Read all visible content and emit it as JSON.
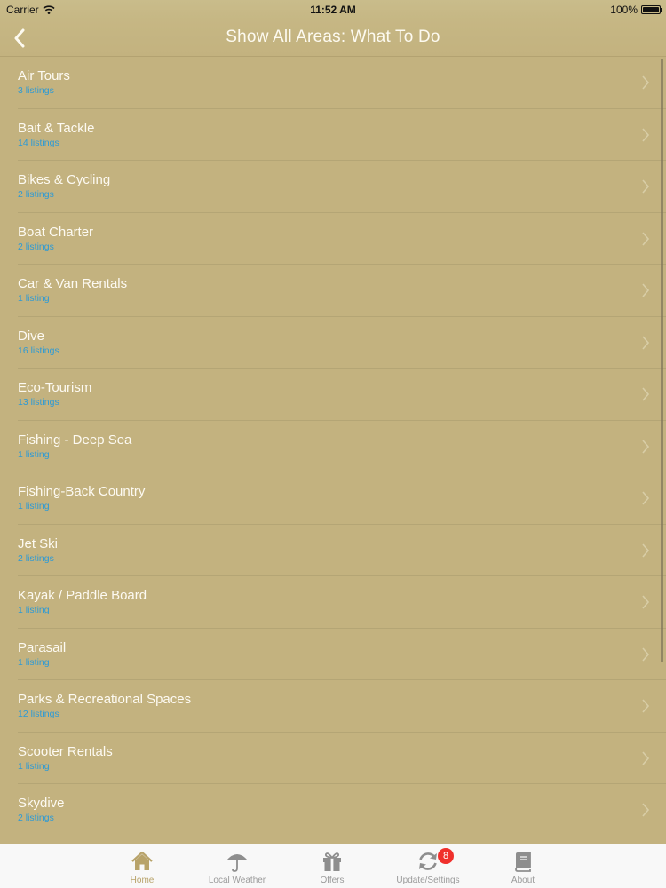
{
  "status_bar": {
    "carrier": "Carrier",
    "time": "11:52 AM",
    "battery": "100%"
  },
  "nav": {
    "title": "Show All Areas: What To Do"
  },
  "categories": [
    {
      "name": "Air Tours",
      "count": "3 listings"
    },
    {
      "name": "Bait & Tackle",
      "count": "14 listings"
    },
    {
      "name": "Bikes & Cycling",
      "count": "2 listings"
    },
    {
      "name": "Boat Charter",
      "count": "2 listings"
    },
    {
      "name": "Car & Van Rentals",
      "count": "1 listing"
    },
    {
      "name": "Dive",
      "count": "16 listings"
    },
    {
      "name": "Eco-Tourism",
      "count": "13 listings"
    },
    {
      "name": "Fishing - Deep Sea",
      "count": "1 listing"
    },
    {
      "name": "Fishing-Back Country",
      "count": "1 listing"
    },
    {
      "name": "Jet Ski",
      "count": "2 listings"
    },
    {
      "name": "Kayak / Paddle Board",
      "count": "1 listing"
    },
    {
      "name": "Parasail",
      "count": "1 listing"
    },
    {
      "name": "Parks & Recreational Spaces",
      "count": "12 listings"
    },
    {
      "name": "Scooter Rentals",
      "count": "1 listing"
    },
    {
      "name": "Skydive",
      "count": "2 listings"
    }
  ],
  "tabs": [
    {
      "label": "Home",
      "icon": "home-icon"
    },
    {
      "label": "Local Weather",
      "icon": "umbrella-icon"
    },
    {
      "label": "Offers",
      "icon": "gift-icon"
    },
    {
      "label": "Update/Settings",
      "icon": "refresh-icon",
      "badge": "8"
    },
    {
      "label": "About",
      "icon": "book-icon"
    }
  ],
  "colors": {
    "background": "#c3b27f",
    "listing_count": "#2c9ad6",
    "active_tab": "#b8a36a",
    "badge": "#f0302c"
  }
}
